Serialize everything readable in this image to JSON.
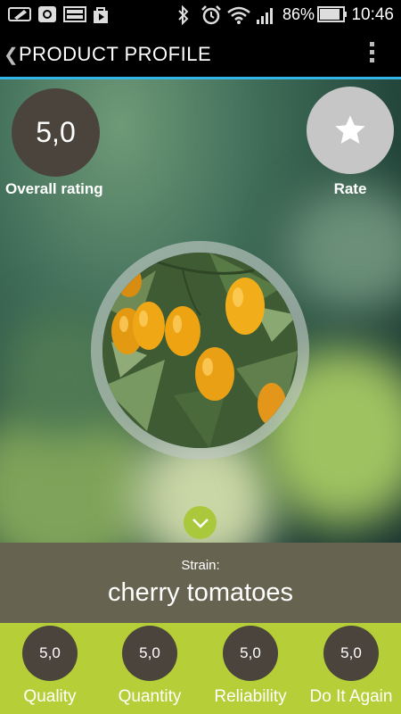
{
  "status_bar": {
    "icons": [
      "pencil-icon",
      "camera-icon",
      "image-icon",
      "play-store-icon",
      "bluetooth-icon",
      "alarm-icon",
      "wifi-icon",
      "signal-icon",
      "battery-icon"
    ],
    "battery_percent": "86%",
    "time": "10:46"
  },
  "action_bar": {
    "title": "PRODUCT PROFILE",
    "back_icon": "chevron-left-icon",
    "menu_icon": "overflow-menu-icon"
  },
  "overall": {
    "value": "5,0",
    "label": "Overall rating"
  },
  "rate": {
    "label": "Rate",
    "icon": "star-icon"
  },
  "product_image": "yellow-cherry-tomatoes-photo",
  "expand_icon": "chevron-down-icon",
  "strain": {
    "label": "Strain:",
    "name": "cherry tomatoes"
  },
  "ratings": [
    {
      "value": "5,0",
      "label": "Quality"
    },
    {
      "value": "5,0",
      "label": "Quantity"
    },
    {
      "value": "5,0",
      "label": "Reliability"
    },
    {
      "value": "5,0",
      "label": "Do It Again"
    }
  ],
  "colors": {
    "accent_line": "#33b5e5",
    "rating_bar": "#b6cf38",
    "circle_dark": "#4a443c",
    "rate_circle": "#c6c6c6",
    "expand_button": "#a9c83c"
  }
}
